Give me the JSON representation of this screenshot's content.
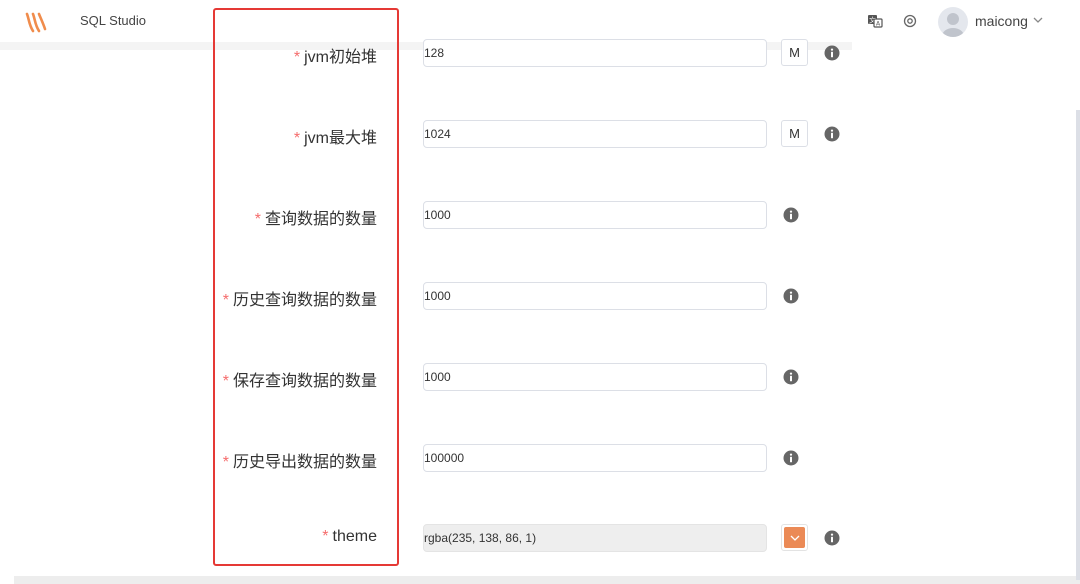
{
  "header": {
    "app_title": "SQL Studio",
    "username": "maicong",
    "icons": [
      "logo",
      "translate-icon",
      "settings-icon",
      "avatar",
      "chevron-down-icon"
    ]
  },
  "form": {
    "rows": [
      {
        "label": "jvm初始堆",
        "value": "128",
        "unit": "M"
      },
      {
        "label": "jvm最大堆",
        "value": "1024",
        "unit": "M"
      },
      {
        "label": "查询数据的数量",
        "value": "1000"
      },
      {
        "label": "历史查询数据的数量",
        "value": "1000"
      },
      {
        "label": "保存查询数据的数量",
        "value": "1000"
      },
      {
        "label": "历史导出数据的数量",
        "value": "100000"
      },
      {
        "label": "theme",
        "value": "rgba(235, 138, 86, 1)"
      }
    ],
    "required_mark": "*"
  },
  "colors": {
    "theme_swatch": "#eb8a56",
    "highlight_border": "#e53935",
    "required": "#f56c6c",
    "brand": "#f08c4c"
  }
}
